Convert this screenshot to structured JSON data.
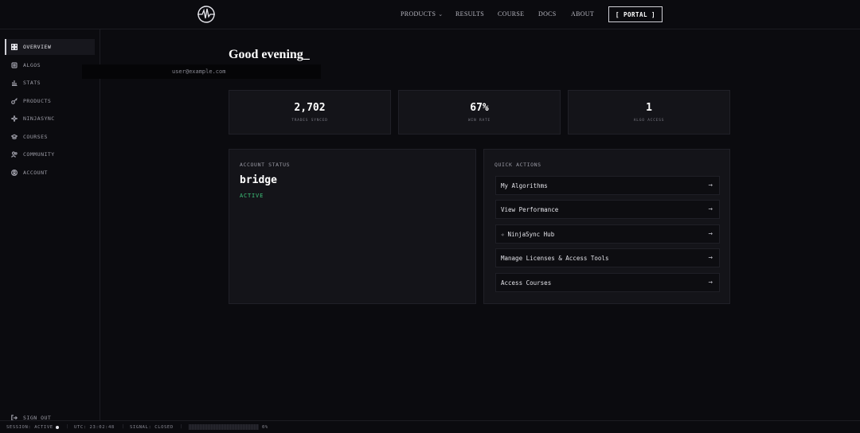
{
  "nav": {
    "items": [
      {
        "label": "PRODUCTS",
        "has_dropdown": true
      },
      {
        "label": "RESULTS"
      },
      {
        "label": "COURSE"
      },
      {
        "label": "DOCS"
      },
      {
        "label": "ABOUT"
      }
    ],
    "portal_label": "[ PORTAL ]"
  },
  "sidebar": {
    "items": [
      {
        "label": "OVERVIEW",
        "icon": "grid-icon",
        "active": true
      },
      {
        "label": "ALGOS",
        "icon": "chip-icon"
      },
      {
        "label": "STATS",
        "icon": "bar-chart-icon"
      },
      {
        "label": "PRODUCTS",
        "icon": "key-icon"
      },
      {
        "label": "NINJASYNC",
        "icon": "sparkle-icon"
      },
      {
        "label": "COURSES",
        "icon": "graduation-cap-icon"
      },
      {
        "label": "COMMUNITY",
        "icon": "users-icon"
      },
      {
        "label": "ACCOUNT",
        "icon": "user-circle-icon"
      }
    ],
    "signout_label": "SIGN OUT"
  },
  "main": {
    "greeting": "Good evening_",
    "email": "user@example.com",
    "stats": [
      {
        "value": "2,702",
        "label": "TRADES SYNCED"
      },
      {
        "value": "67%",
        "label": "WIN RATE"
      },
      {
        "value": "1",
        "label": "ALGO ACCESS"
      }
    ],
    "account_status": {
      "title": "ACCOUNT STATUS",
      "name": "bridge",
      "status": "ACTIVE",
      "status_color": "#3ec27a"
    },
    "quick_actions": {
      "title": "QUICK ACTIONS",
      "items": [
        {
          "label": "My Algorithms"
        },
        {
          "label": "View Performance"
        },
        {
          "label": "NinjaSync Hub",
          "icon": "sparkle-icon"
        },
        {
          "label": "Manage Licenses & Access Tools"
        },
        {
          "label": "Access Courses"
        }
      ]
    }
  },
  "statusbar": {
    "session": "SESSION: ACTIVE",
    "utc": "UTC: 23:02:48",
    "signal": "SIGNAL: CLOSED",
    "progress_text": "0%",
    "progress_value": 0
  }
}
